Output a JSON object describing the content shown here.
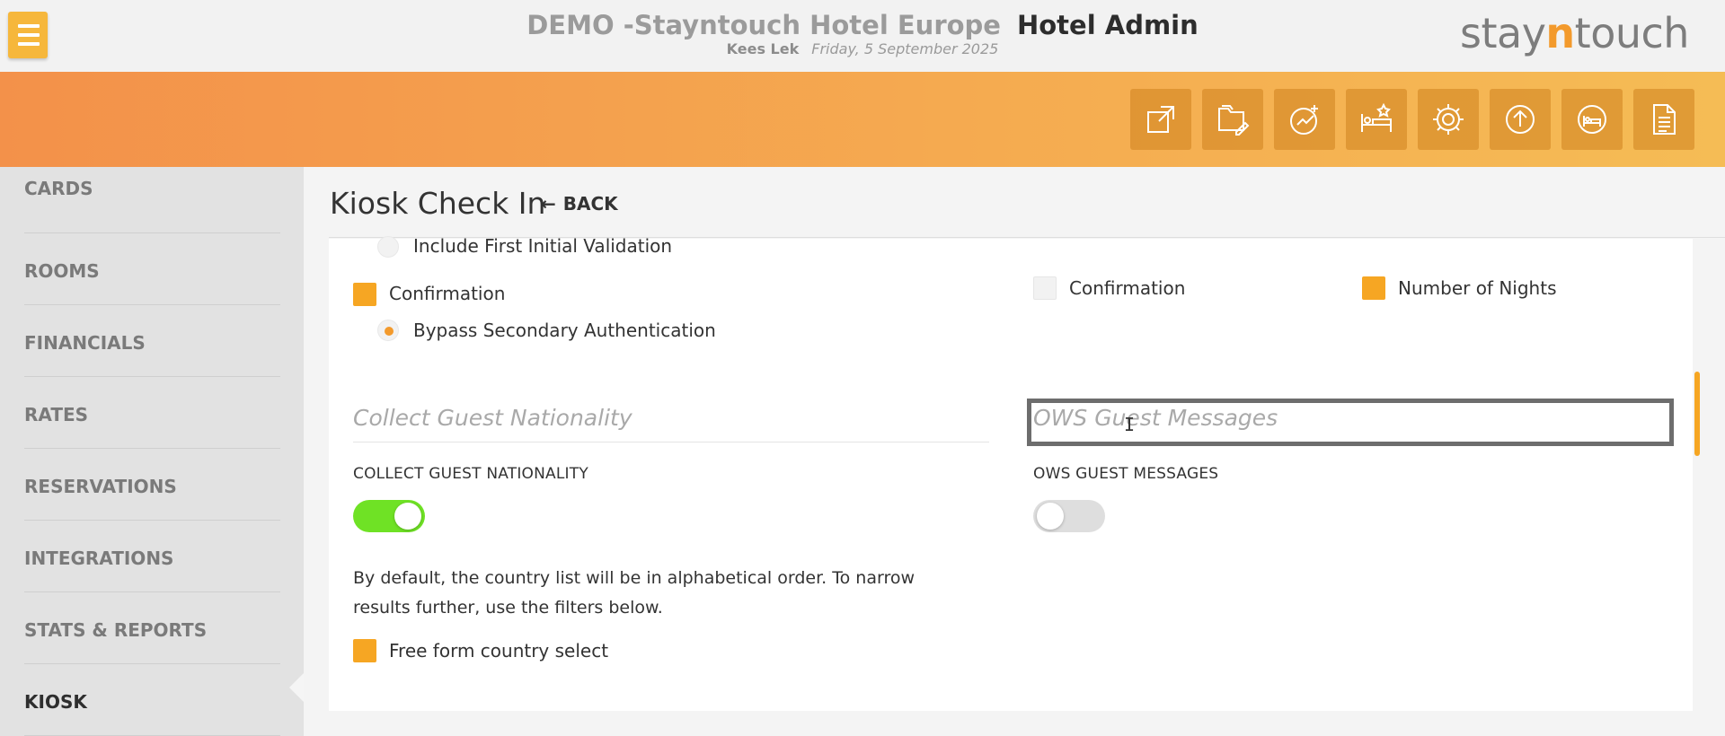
{
  "header": {
    "hotel_name": "DEMO -Stayntouch Hotel Europe",
    "app_name": "Hotel Admin",
    "user": "Kees Lek",
    "date": "Friday, 5 September 2025",
    "logo_part1": "stay",
    "logo_part2": "n",
    "logo_part3": "touch"
  },
  "toolbar": {
    "icons": [
      "open-external-icon",
      "folder-edit-icon",
      "sparkle-chart-icon",
      "bed-star-icon",
      "gear-icon",
      "upload-circle-icon",
      "bed-circle-icon",
      "document-icon"
    ]
  },
  "sidebar": {
    "items": [
      {
        "label": "CARDS"
      },
      {
        "label": "ROOMS"
      },
      {
        "label": "FINANCIALS"
      },
      {
        "label": "RATES"
      },
      {
        "label": "RESERVATIONS"
      },
      {
        "label": "INTEGRATIONS"
      },
      {
        "label": "STATS & REPORTS"
      },
      {
        "label": "KIOSK"
      }
    ],
    "active": "KIOSK"
  },
  "page": {
    "title": "Kiosk Check In",
    "back_label": "BACK"
  },
  "form": {
    "include_first_initial": {
      "label": "Include First Initial Validation",
      "selected": false
    },
    "confirmation_left": {
      "label": "Confirmation",
      "checked": true
    },
    "bypass_secondary": {
      "label": "Bypass Secondary Authentication",
      "selected": true
    },
    "confirmation_right": {
      "label": "Confirmation",
      "checked": false
    },
    "number_of_nights": {
      "label": "Number of Nights",
      "checked": true
    },
    "nationality_section": "Collect Guest Nationality",
    "ows_section": "OWS Guest Messages",
    "nationality_label": "COLLECT GUEST NATIONALITY",
    "nationality_toggle": true,
    "ows_label": "OWS GUEST MESSAGES",
    "ows_toggle": false,
    "nationality_help": "By default, the country list will be in alphabetical order. To narrow results further, use the filters below.",
    "free_form_country": {
      "label": "Free form country select",
      "checked": true
    }
  },
  "colors": {
    "accent": "#f6a623",
    "toggle_on": "#6fe225",
    "brand_orange": "#f39a2c"
  }
}
